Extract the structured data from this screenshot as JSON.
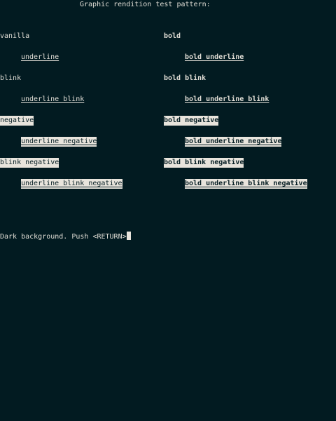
{
  "title": "Graphic rendition test pattern:",
  "rows": [
    {
      "left": "vanilla",
      "right": "bold"
    },
    {
      "left": "underline",
      "right": "bold underline"
    },
    {
      "left": "blink",
      "right": "bold blink"
    },
    {
      "left": "underline blink",
      "right": "bold underline blink"
    },
    {
      "left": "negative",
      "right": "bold negative"
    },
    {
      "left": "underline negative",
      "right": "bold underline negative"
    },
    {
      "left": "blink negative",
      "right": "bold blink negative"
    },
    {
      "left": "underline blink negative",
      "right": "bold underline blink negative"
    }
  ],
  "prompt": "Dark background. Push <RETURN>",
  "colors": {
    "background": "#021b21",
    "foreground": "#e0ddd5",
    "negative_bg": "#e8e4dc",
    "negative_fg": "#061e24"
  }
}
